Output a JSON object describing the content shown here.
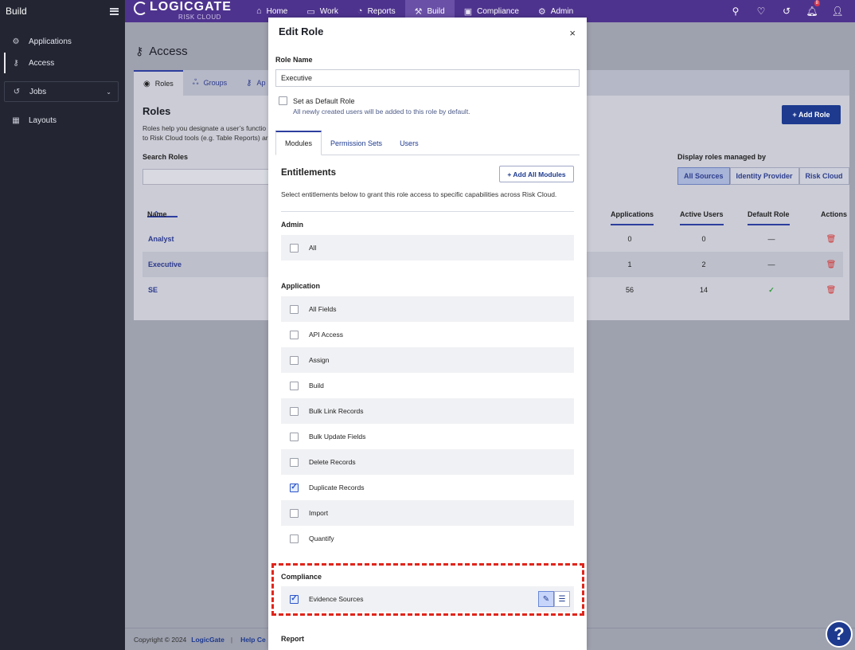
{
  "sidebar": {
    "title": "Build",
    "items": [
      {
        "label": "Applications",
        "icon": "applications-icon"
      },
      {
        "label": "Access",
        "icon": "key-icon"
      },
      {
        "label": "Jobs",
        "icon": "history-icon"
      },
      {
        "label": "Layouts",
        "icon": "layouts-icon"
      }
    ]
  },
  "topnav": {
    "logo_name": "LOGICGATE",
    "logo_sub": "RISK CLOUD",
    "items": [
      {
        "label": "Home"
      },
      {
        "label": "Work"
      },
      {
        "label": "Reports"
      },
      {
        "label": "Build"
      },
      {
        "label": "Compliance"
      },
      {
        "label": "Admin"
      }
    ],
    "notification_count": "8"
  },
  "page": {
    "title": "Access",
    "tabs": [
      {
        "label": "Roles"
      },
      {
        "label": "Groups"
      },
      {
        "label": "Ap"
      }
    ],
    "roles_heading": "Roles",
    "roles_desc": "Roles help you designate a user’s functio\nto Risk Cloud tools (e.g. Table Reports) ar",
    "search_label": "Search Roles",
    "add_role": "+ Add Role",
    "display_label": "Display roles managed by",
    "sources": [
      "All Sources",
      "Identity Provider",
      "Risk Cloud"
    ],
    "columns": {
      "name": "Name",
      "applications": "Applications",
      "active_users": "Active Users",
      "default_role": "Default Role",
      "actions": "Actions"
    },
    "rows": [
      {
        "name": "Analyst",
        "applications": "0",
        "active_users": "0",
        "default_role": "—"
      },
      {
        "name": "Executive",
        "applications": "1",
        "active_users": "2",
        "default_role": "—"
      },
      {
        "name": "SE",
        "applications": "56",
        "active_users": "14",
        "default_role": "✓"
      }
    ],
    "footer": {
      "copyright": "Copyright © 2024",
      "company": "LogicGate",
      "help": "Help Ce"
    }
  },
  "modal": {
    "title": "Edit Role",
    "close": "×",
    "role_name_label": "Role Name",
    "role_name_value": "Executive",
    "default_label": "Set as Default Role",
    "default_hint": "All newly created users will be added to this role by default.",
    "tabs": [
      "Modules",
      "Permission Sets",
      "Users"
    ],
    "entitlements_heading": "Entitlements",
    "add_all": "+ Add All Modules",
    "entitlements_desc": "Select entitlements below to grant this role access to specific capabilities across Risk Cloud.",
    "sections": {
      "admin": {
        "heading": "Admin",
        "items": [
          {
            "label": "All",
            "checked": false
          }
        ]
      },
      "application": {
        "heading": "Application",
        "items": [
          {
            "label": "All Fields",
            "checked": false
          },
          {
            "label": "API Access",
            "checked": false
          },
          {
            "label": "Assign",
            "checked": false
          },
          {
            "label": "Build",
            "checked": false
          },
          {
            "label": "Bulk Link Records",
            "checked": false
          },
          {
            "label": "Bulk Update Fields",
            "checked": false
          },
          {
            "label": "Delete Records",
            "checked": false
          },
          {
            "label": "Duplicate Records",
            "checked": true
          },
          {
            "label": "Import",
            "checked": false
          },
          {
            "label": "Quantify",
            "checked": false
          }
        ]
      },
      "compliance": {
        "heading": "Compliance",
        "items": [
          {
            "label": "Evidence Sources",
            "checked": true
          }
        ]
      },
      "report": {
        "heading": "Report"
      }
    }
  },
  "colors": {
    "nav": "#4e338e",
    "sidebar": "#232632",
    "accent": "#1d3a8f",
    "highlight": "#e0251b"
  }
}
